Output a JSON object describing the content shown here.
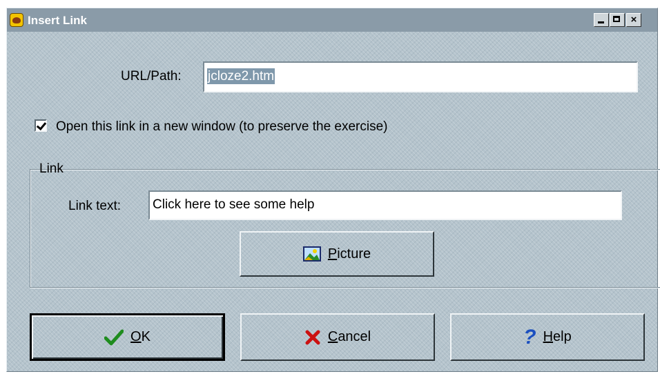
{
  "window": {
    "title": "Insert Link",
    "controls": {
      "minimize": "_",
      "maximize": "□",
      "close": "×"
    }
  },
  "url": {
    "label": "URL/Path:",
    "value": "jcloze2.htm",
    "selected": true
  },
  "new_window_option": {
    "label": "Open this link in a new window (to preserve the exercise)",
    "checked": true
  },
  "link_group": {
    "title": "Link",
    "link_text_label": "Link text:",
    "link_text_value": "Click here to see some help",
    "picture_button": {
      "label_prefix": "",
      "mnemonic": "P",
      "label_rest": "icture",
      "icon": "picture-icon"
    }
  },
  "buttons": {
    "ok": {
      "mnemonic": "O",
      "rest": "K",
      "icon": "checkmark-icon",
      "icon_color": "#1e8c1e"
    },
    "cancel": {
      "mnemonic": "C",
      "rest": "ancel",
      "icon": "cross-icon",
      "icon_color": "#cc1111"
    },
    "help": {
      "mnemonic": "H",
      "rest": "elp",
      "icon": "question-mark-icon",
      "icon_color": "#1a4fc0",
      "icon_glyph": "?"
    }
  },
  "colors": {
    "titlebar": "#8a9ba8",
    "dialog_bg": "#b4c3cc",
    "selection": "#7f98ab"
  }
}
